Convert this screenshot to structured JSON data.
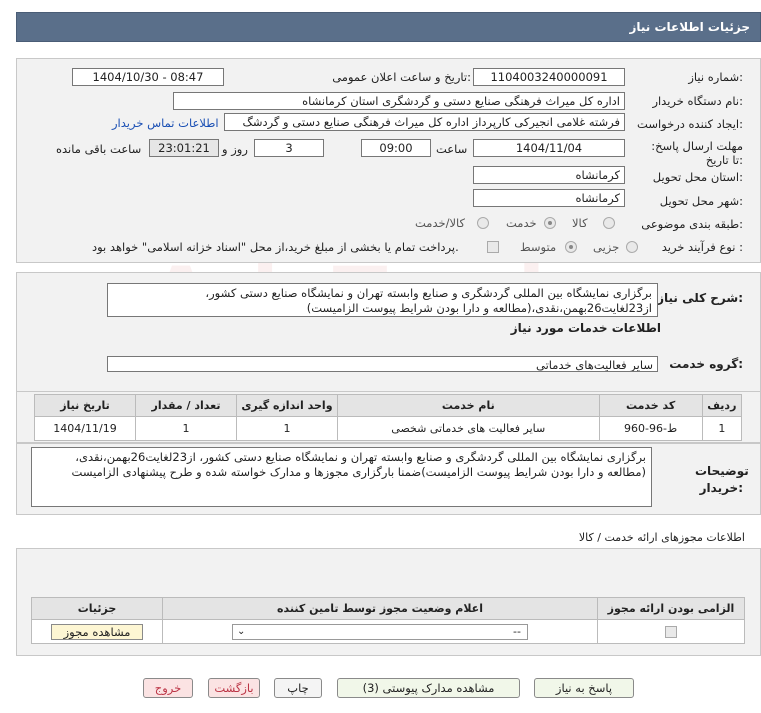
{
  "header": {
    "title": "جزئیات اطلاعات نیاز"
  },
  "watermark": "AriaTender.net",
  "info": {
    "need_number_label": "شماره نیاز:",
    "need_number": "1104003240000091",
    "announce_label": "تاریخ و ساعت اعلان عمومی:",
    "announce_value": "1404/10/30 - 08:47",
    "buyer_org_label": "نام دستگاه خریدار:",
    "buyer_org": "اداره کل میراث فرهنگی  صنایع دستی و گردشگری استان کرمانشاه",
    "creator_label": "ایجاد کننده درخواست:",
    "creator": "فرشته غلامی انجیرکی کارپرداز اداره کل میراث فرهنگی  صنایع دستی و گردشگ",
    "contact_link": "اطلاعات تماس خریدار",
    "deadline_label": "مهلت ارسال پاسخ: تا تاریخ:",
    "deadline_date": "1404/11/04",
    "time_label": "ساعت",
    "deadline_time": "09:00",
    "days_value": "3",
    "days_label": "روز و",
    "remaining_time": "23:01:21",
    "remaining_label": "ساعت باقی مانده",
    "province_label": "استان محل تحویل:",
    "province": "کرمانشاه",
    "city_label": "شهر محل تحویل:",
    "city": "کرمانشاه",
    "category_label": "طبقه بندی موضوعی:",
    "category_options": [
      "کالا",
      "خدمت",
      "کالا/خدمت"
    ],
    "category_selected": "خدمت",
    "process_label": "نوع فرآیند خرید :",
    "process_options": [
      "جزیی",
      "متوسط"
    ],
    "process_selected": "متوسط",
    "payment_note": "پرداخت تمام یا بخشی از مبلغ خرید،از محل \"اسناد خزانه اسلامی\" خواهد بود."
  },
  "summary": {
    "label": "شرح کلی نیاز:",
    "text": "برگزاری نمایشگاه بین المللی گردشگری و صنایع وابسته تهران و نمایشگاه صنایع دستی کشور، از23لغایت26بهمن،نقدی،(مطالعه و دارا بودن شرایط پیوست الزامیست)"
  },
  "services": {
    "section_title": "اطلاعات خدمات مورد نیاز",
    "group_label": "گروه خدمت:",
    "group_value": "سایر فعالیت‌های خدماتی",
    "columns": [
      "ردیف",
      "کد خدمت",
      "نام خدمت",
      "واحد اندازه گیری",
      "تعداد / مقدار",
      "تاریخ نیاز"
    ],
    "rows": [
      {
        "row": "1",
        "code": "ط-96-960",
        "name": "سایر فعالیت های خدماتی شخصی",
        "unit": "1",
        "qty": "1",
        "date": "1404/11/19"
      }
    ]
  },
  "buyer_notes": {
    "label": "توضیحات خریدار:",
    "text": "برگزاری نمایشگاه بین المللی گردشگری و صنایع وابسته تهران و نمایشگاه صنایع دستی کشور، از23لغایت26بهمن،نقدی،(مطالعه و دارا بودن شرایط پیوست الزامیست)ضمنا بارگزاری مجوزها و مدارک خواسته شده و  طرح پیشنهادی الزامیست"
  },
  "permits": {
    "title": "اطلاعات مجوزهای ارائه خدمت / کالا",
    "columns": [
      "الزامی بودن ارائه مجوز",
      "اعلام وضعیت مجوز توسط تامین کننده",
      "جزئیات"
    ],
    "select_value": "--",
    "view_button": "مشاهده مجوز"
  },
  "buttons": {
    "reply": "پاسخ به نیاز",
    "attachments": "مشاهده مدارک پیوستی (3)",
    "print": "چاپ",
    "back": "بازگشت",
    "exit": "خروج"
  }
}
